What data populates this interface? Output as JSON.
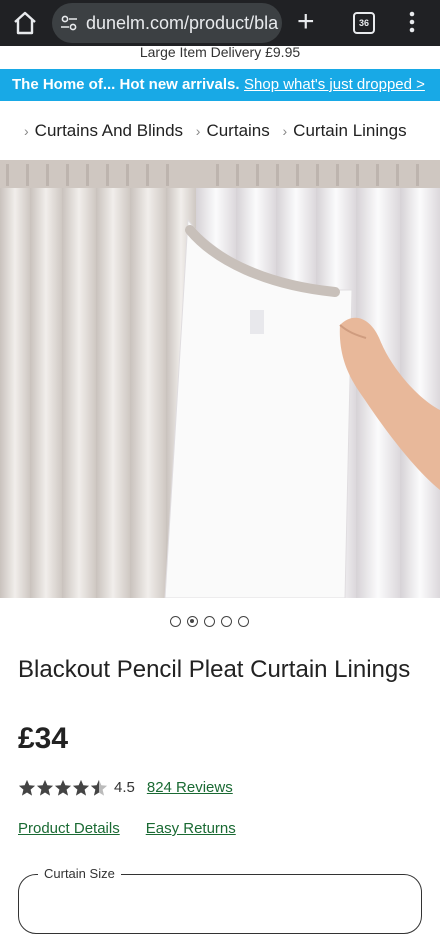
{
  "browser": {
    "url": "dunelm.com/product/bla",
    "tab_count": "36"
  },
  "delivery_banner": "Large Item Delivery £9.95",
  "promo": {
    "message": "The Home of... Hot new arrivals.",
    "link": "Shop what's just dropped >"
  },
  "breadcrumb": {
    "items": [
      "Curtains And Blinds",
      "Curtains",
      "Curtain Linings"
    ]
  },
  "gallery": {
    "current": 2,
    "total": 5
  },
  "product": {
    "title": "Blackout Pencil Pleat Curtain Linings",
    "price": "£34",
    "rating_value": "4.5",
    "rating_stars": 4.5,
    "reviews": "824 Reviews"
  },
  "links": {
    "details": "Product Details",
    "returns": "Easy Returns"
  },
  "size_selector": {
    "label": "Curtain Size"
  },
  "colors": {
    "promo_bg": "#18a9e6",
    "link_green": "#1a6a33",
    "chrome_bg": "#202124"
  }
}
